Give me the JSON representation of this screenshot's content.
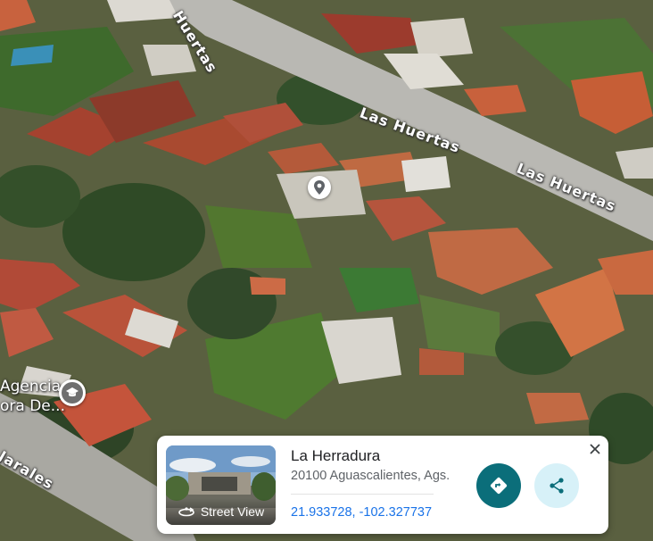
{
  "map": {
    "streets": [
      {
        "name": "Huertas"
      },
      {
        "name": "Las Huertas"
      },
      {
        "name": "Las Huertas"
      },
      {
        "name": "Jarales"
      }
    ],
    "places": {
      "agency_line1": "Agencia",
      "agency_line2": "ora De..."
    }
  },
  "card": {
    "title": "La Herradura",
    "address": "20100 Aguascalientes, Ags.",
    "coordinates": "21.933728, -102.327737",
    "street_view_label": "Street View",
    "directions_icon": "directions-icon",
    "share_icon": "share-icon",
    "close_icon": "close-icon"
  },
  "colors": {
    "accent_teal": "#0b6e7a",
    "share_bg": "#d7f1f8",
    "link_blue": "#1a73e8"
  }
}
